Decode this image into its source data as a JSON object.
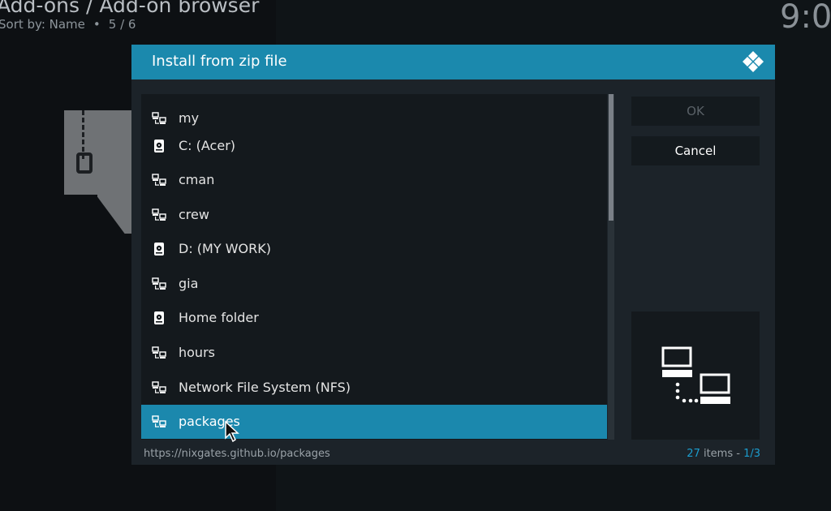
{
  "topbar": {
    "breadcrumb": "Add-ons / Add-on browser",
    "sort_label": "Sort by: Name",
    "position": "5 / 6",
    "clock": "9:0"
  },
  "dialog": {
    "title": "Install from zip file",
    "items": [
      {
        "label": "my",
        "icon": "network-share-icon"
      },
      {
        "label": "C: (Acer)",
        "icon": "hard-drive-icon"
      },
      {
        "label": "cman",
        "icon": "network-share-icon"
      },
      {
        "label": "crew",
        "icon": "network-share-icon"
      },
      {
        "label": "D: (MY WORK)",
        "icon": "hard-drive-icon"
      },
      {
        "label": "gia",
        "icon": "network-share-icon"
      },
      {
        "label": "Home folder",
        "icon": "hard-drive-icon"
      },
      {
        "label": "hours",
        "icon": "network-share-icon"
      },
      {
        "label": "Network File System (NFS)",
        "icon": "network-share-icon"
      },
      {
        "label": "packages",
        "icon": "network-share-icon",
        "selected": true
      }
    ],
    "ok_label": "OK",
    "cancel_label": "Cancel",
    "path": "https://nixgates.github.io/packages",
    "count_number": "27",
    "count_word": " items - ",
    "page": "1/3"
  },
  "colors": {
    "accent": "#1b89ad",
    "dialog_bg": "#1c2329"
  }
}
